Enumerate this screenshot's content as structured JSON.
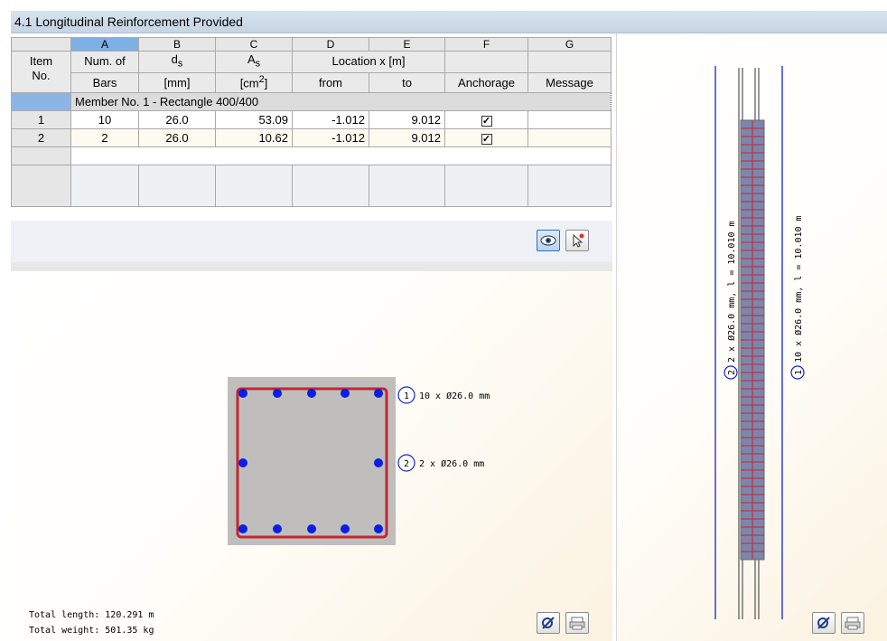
{
  "window": {
    "title": "4.1 Longitudinal Reinforcement Provided"
  },
  "table": {
    "column_letters": [
      "A",
      "B",
      "C",
      "D",
      "E",
      "F",
      "G"
    ],
    "item_header": [
      "Item",
      "No."
    ],
    "headers_top": {
      "a": "Num. of",
      "b": "d",
      "b_sub": "s",
      "c": "A",
      "c_sub": "s",
      "de": "Location x [m]",
      "f": "",
      "g": ""
    },
    "headers_bottom": {
      "a": "Bars",
      "b": "[mm]",
      "c": "[cm",
      "c_sup": "2",
      "c_end": "]",
      "d": "from",
      "e": "to",
      "f": "Anchorage",
      "g": "Message"
    },
    "member_label": "Member No. 1 - Rectangle 400/400",
    "rows": [
      {
        "item": "1",
        "bars": "10",
        "ds": "26.0",
        "as": "53.09",
        "from": "-1.012",
        "to": "9.012",
        "anchorage": "✓",
        "message": ""
      },
      {
        "item": "2",
        "bars": "2",
        "ds": "26.0",
        "as": "10.62",
        "from": "-1.012",
        "to": "9.012",
        "anchorage": "✓",
        "message": ""
      }
    ]
  },
  "toolbar": {
    "view_icon": "eye-icon",
    "pick_icon": "pointer-pick-icon"
  },
  "section": {
    "callouts": [
      {
        "num": "1",
        "text": "10 x Ø26.0 mm"
      },
      {
        "num": "2",
        "text": "2 x Ø26.0 mm"
      }
    ],
    "total_length": "Total length: 120.291 m",
    "total_weight": "Total weight: 501.35 kg",
    "colors": {
      "concrete": "#c0bebc",
      "stirrup": "#c0282d",
      "bar": "#0a1ee6",
      "dim_line": "#1424c8"
    }
  },
  "elevation": {
    "label_left_num": "2",
    "label_left": "2 x Ø26.0 mm, l = 10.010 m",
    "label_right_num": "1",
    "label_right": "10 x Ø26.0 mm, l = 10.010 m"
  },
  "bottom_buttons": {
    "settings_icon": "display-options-icon",
    "print_icon": "print-icon"
  }
}
